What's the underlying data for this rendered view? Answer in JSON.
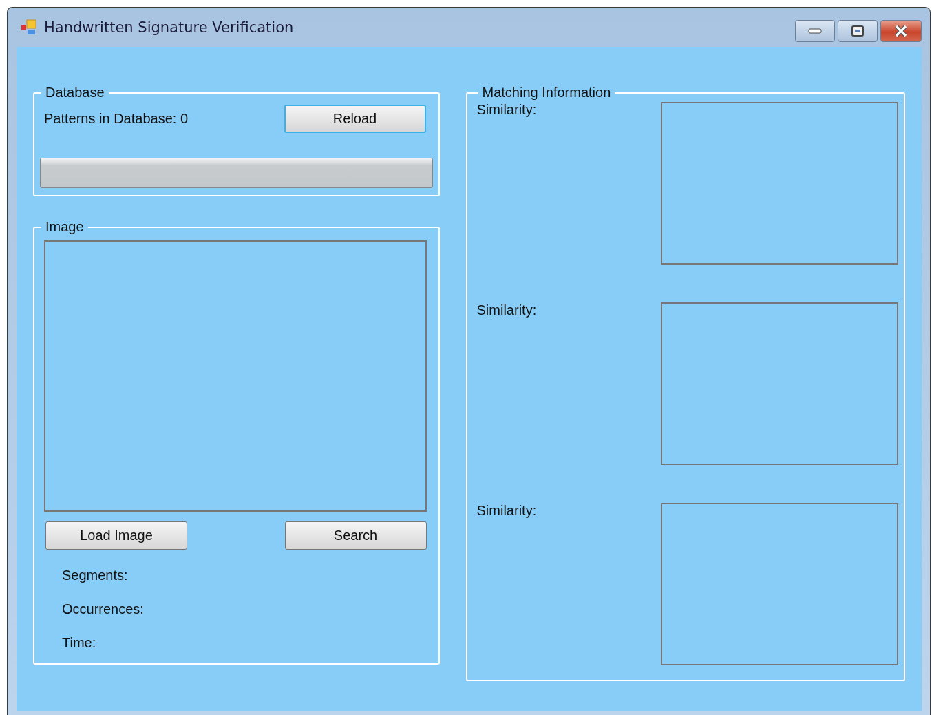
{
  "window": {
    "title": "Handwritten Signature Verification"
  },
  "database": {
    "title": "Database",
    "patterns_label": "Patterns in Database: 0",
    "reload_button": {
      "label": "Reload",
      "focused": true
    },
    "progress": {
      "level": 0
    }
  },
  "image": {
    "title": "Image",
    "load_button": "Load Image",
    "search_button": "Search",
    "stats": [
      "Segments:",
      "Occurrences:",
      "Time:"
    ]
  },
  "matching": {
    "title": "Matching Information",
    "results": [
      {
        "label": "Similarity:"
      },
      {
        "label": "Similarity:"
      },
      {
        "label": "Similarity:"
      }
    ]
  }
}
